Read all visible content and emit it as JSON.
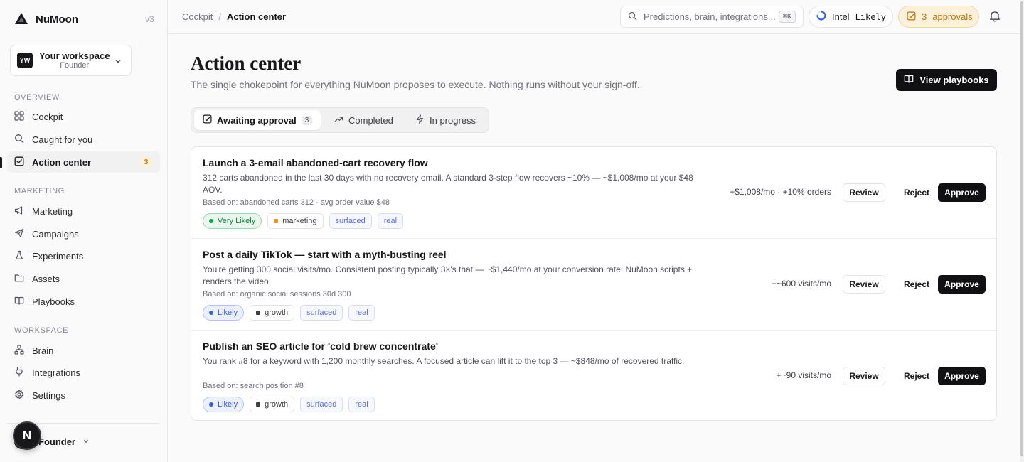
{
  "app": {
    "name": "NuMoon",
    "version": "v3"
  },
  "workspace": {
    "initials": "YW",
    "name": "Your workspace",
    "role": "Founder"
  },
  "sidebar": {
    "sections": [
      {
        "label": "Overview",
        "items": [
          {
            "label": "Cockpit",
            "icon": "grid-icon"
          },
          {
            "label": "Caught for you",
            "icon": "search-icon"
          },
          {
            "label": "Action center",
            "icon": "check-square-icon",
            "active": true,
            "badge": "3"
          }
        ]
      },
      {
        "label": "Marketing",
        "items": [
          {
            "label": "Marketing",
            "icon": "megaphone-icon"
          },
          {
            "label": "Campaigns",
            "icon": "send-icon"
          },
          {
            "label": "Experiments",
            "icon": "flask-icon"
          },
          {
            "label": "Assets",
            "icon": "folder-icon"
          },
          {
            "label": "Playbooks",
            "icon": "book-icon"
          }
        ]
      },
      {
        "label": "Workspace",
        "items": [
          {
            "label": "Brain",
            "icon": "network-icon"
          },
          {
            "label": "Integrations",
            "icon": "plug-icon"
          },
          {
            "label": "Settings",
            "icon": "gear-icon"
          }
        ]
      }
    ],
    "user": {
      "name": "Founder"
    },
    "fab_letter": "N"
  },
  "topbar": {
    "breadcrumb": {
      "root": "Cockpit",
      "separator": "/",
      "current": "Action center"
    },
    "search": {
      "placeholder": "Predictions, brain, integrations...",
      "shortcut": "⌘K"
    },
    "intel": {
      "label": "Intel",
      "value": "Likely"
    },
    "approvals": {
      "count": "3",
      "label": "approvals"
    }
  },
  "page": {
    "title": "Action center",
    "subtitle": "The single chokepoint for everything NuMoon proposes to execute. Nothing runs without your sign-off.",
    "primary_button": "View playbooks"
  },
  "tabs": [
    {
      "label": "Awaiting approval",
      "count": "3",
      "active": true
    },
    {
      "label": "Completed"
    },
    {
      "label": "In progress"
    }
  ],
  "actions_labels": {
    "review": "Review",
    "reject": "Reject",
    "approve": "Approve"
  },
  "proposals": [
    {
      "title": "Launch a 3-email abandoned-cart recovery flow",
      "description": "312 carts abandoned in the last 30 days with no recovery email. A standard 3-step flow recovers ~10% — ~$1,008/mo at your $48 AOV.",
      "basis": "Based on: abandoned carts 312 · avg order value $48",
      "confidence": "Very Likely",
      "category": "marketing",
      "category_color": "#e8952d",
      "tags": [
        "surfaced",
        "real"
      ],
      "impact": "+$1,008/mo · +10% orders"
    },
    {
      "title": "Post a daily TikTok — start with a myth-busting reel",
      "description": "You're getting 300 social visits/mo. Consistent posting typically 3×'s that — ~$1,440/mo at your conversion rate. NuMoon scripts + renders the video.",
      "basis": "Based on: organic social sessions 30d 300",
      "confidence": "Likely",
      "category": "growth",
      "category_color": "#3f3f46",
      "tags": [
        "surfaced",
        "real"
      ],
      "impact": "+~600 visits/mo"
    },
    {
      "title": "Publish an SEO article for 'cold brew concentrate'",
      "description": "You rank #8 for a keyword with 1,200 monthly searches. A focused article can lift it to the top 3 — ~$848/mo of recovered traffic.",
      "basis": "Based on: search position #8",
      "confidence": "Likely",
      "category": "growth",
      "category_color": "#3f3f46",
      "tags": [
        "surfaced",
        "real"
      ],
      "impact": "+~90 visits/mo"
    }
  ]
}
